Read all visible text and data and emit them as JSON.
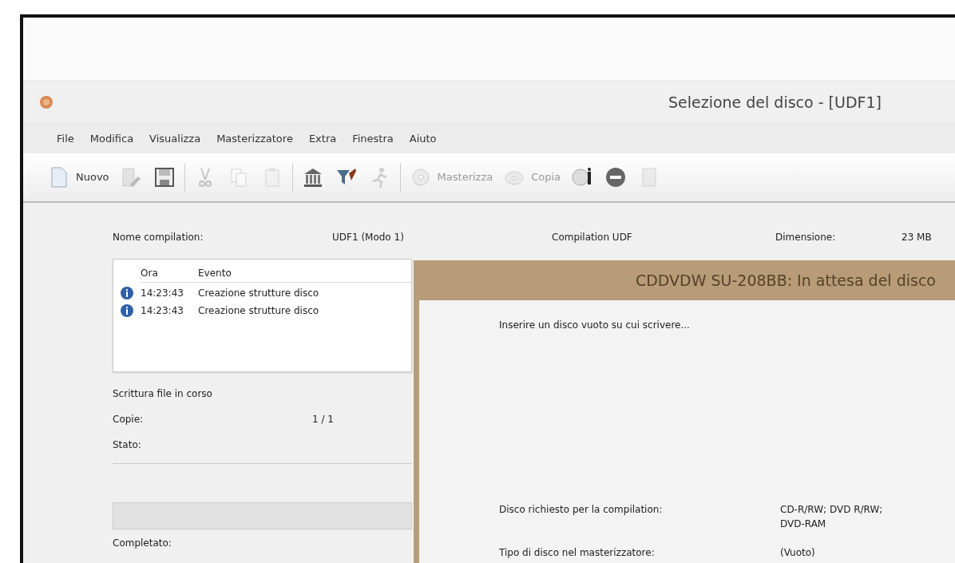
{
  "window": {
    "title": "Selezione del disco - [UDF1]"
  },
  "menu": [
    "File",
    "Modifica",
    "Visualizza",
    "Masterizzatore",
    "Extra",
    "Finestra",
    "Aiuto"
  ],
  "toolbar": [
    {
      "kind": "document",
      "label": "Nuovo",
      "disabled": false
    },
    {
      "kind": "edit",
      "disabled": true
    },
    {
      "kind": "floppy",
      "disabled": false
    },
    {
      "kind": "separator"
    },
    {
      "kind": "scissors",
      "disabled": true
    },
    {
      "kind": "copy",
      "disabled": true
    },
    {
      "kind": "paste",
      "disabled": true
    },
    {
      "kind": "separator"
    },
    {
      "kind": "building",
      "disabled": false
    },
    {
      "kind": "filter",
      "disabled": false
    },
    {
      "kind": "figure",
      "disabled": true
    },
    {
      "kind": "separator"
    },
    {
      "kind": "burn",
      "label": "Masterizza",
      "disabled": true
    },
    {
      "kind": "disc",
      "label": "Copia",
      "disabled": true
    },
    {
      "kind": "info",
      "disabled": false
    },
    {
      "kind": "stop",
      "disabled": false
    },
    {
      "kind": "page",
      "disabled": true
    }
  ],
  "compilation": {
    "name_label": "Nome compilation:",
    "name": "UDF1 (Modo 1)",
    "type": "Compilation UDF",
    "size_label": "Dimensione:",
    "size": "23 MB"
  },
  "log": {
    "columns": [
      "Ora",
      "Evento"
    ],
    "rows": [
      {
        "kind": "info",
        "time": "14:23:43",
        "event": "Creazione strutture disco"
      },
      {
        "kind": "info",
        "time": "14:23:43",
        "event": "Creazione strutture disco"
      }
    ]
  },
  "status": {
    "heading": "Scrittura file in corso",
    "fields": [
      {
        "label": "Copie:",
        "value": "1 / 1"
      },
      {
        "label": "Stato:"
      }
    ]
  },
  "progress": {
    "level": 0
  },
  "completed_label": "Completato:",
  "dialog": {
    "title": "CDDVDW SU-208BB: In attesa del disco",
    "message": "Inserire un disco vuoto su cui scrivere...",
    "fields": [
      {
        "label": "Disco richiesto per la compilation:",
        "value": "CD-R/RW; DVD R/RW; DVD-RAM"
      },
      {
        "label": "Tipo di disco nel masterizzatore:",
        "value": "(Vuoto)"
      }
    ]
  }
}
